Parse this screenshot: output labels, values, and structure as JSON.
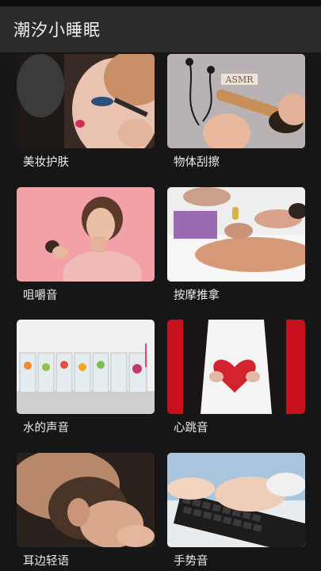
{
  "app": {
    "title": "潮汐小睡眠"
  },
  "categories": [
    {
      "label": "美妆护肤",
      "icon": "makeup-photo"
    },
    {
      "label": "物体刮擦",
      "icon": "asmr-brush-photo"
    },
    {
      "label": "咀嚼音",
      "icon": "chewing-photo"
    },
    {
      "label": "按摩推拿",
      "icon": "massage-photo"
    },
    {
      "label": "水的声音",
      "icon": "water-glasses-photo"
    },
    {
      "label": "心跳音",
      "icon": "heart-photo"
    },
    {
      "label": "耳边轻语",
      "icon": "whisper-photo"
    },
    {
      "label": "手势音",
      "icon": "typing-hands-photo"
    }
  ],
  "thumbnail_text": {
    "asmr_blocks": "ASMR"
  }
}
